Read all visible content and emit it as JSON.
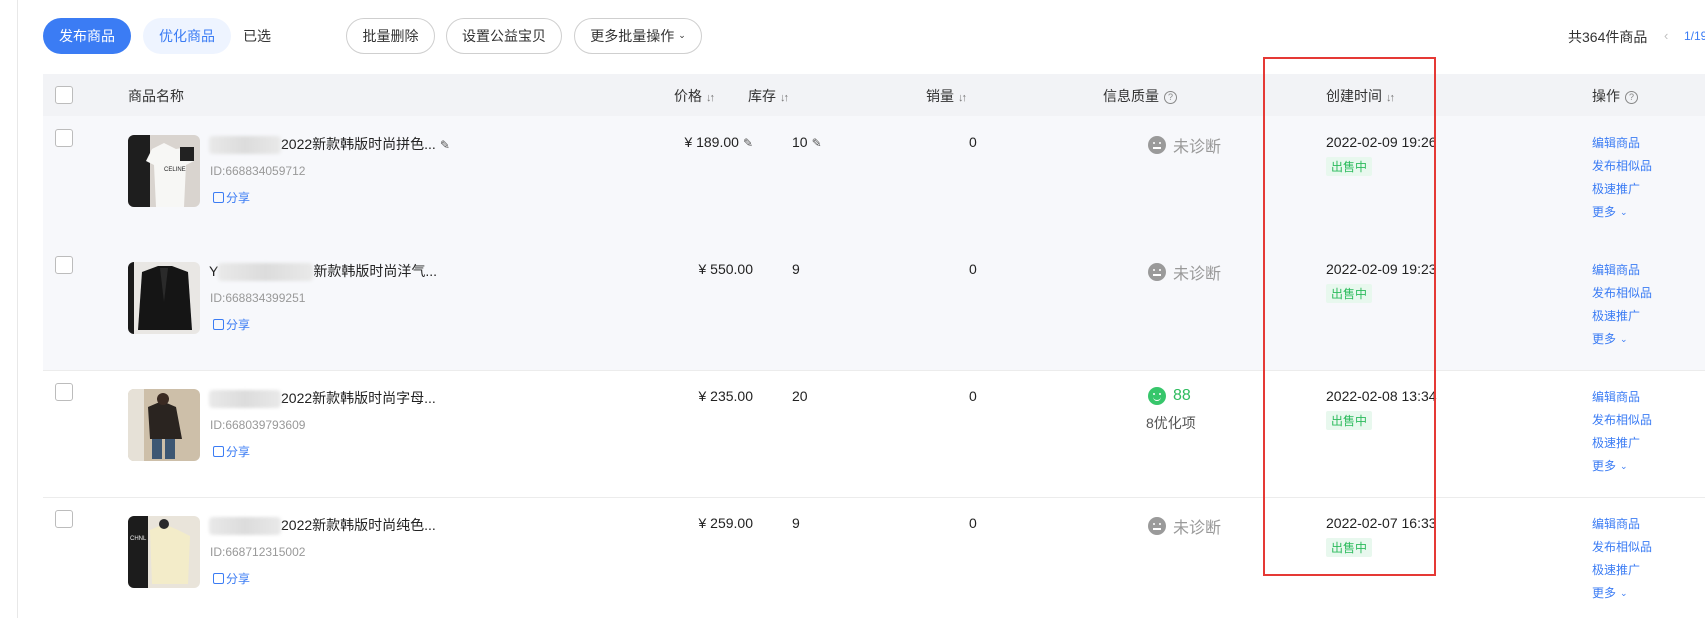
{
  "toolbar": {
    "publish": "发布商品",
    "optimize": "优化商品",
    "selected": "已选",
    "batch_delete": "批量删除",
    "set_charity": "设置公益宝贝",
    "more_batch": "更多批量操作"
  },
  "summary": {
    "total": "共364件商品",
    "prev": "‹",
    "page": "1/19"
  },
  "table": {
    "headers": {
      "name": "商品名称",
      "price": "价格",
      "stock": "库存",
      "sales": "销量",
      "quality": "信息质量",
      "created": "创建时间",
      "actions": "操作"
    },
    "rows": [
      {
        "title_prefix": "",
        "title": "2022新款韩版时尚拼色...",
        "id": "ID:668834059712",
        "share": "分享",
        "price": "¥ 189.00",
        "stock": "10",
        "sales": "0",
        "quality": "未诊断",
        "quality_extra": "",
        "created": "2022-02-09 19:26",
        "status": "出售中"
      },
      {
        "title_prefix": "Y",
        "title": "新款韩版时尚洋气...",
        "id": "ID:668834399251",
        "share": "分享",
        "price": "¥ 550.00",
        "stock": "9",
        "sales": "0",
        "quality": "未诊断",
        "quality_extra": "",
        "created": "2022-02-09 19:23",
        "status": "出售中"
      },
      {
        "title_prefix": "",
        "title": "2022新款韩版时尚字母...",
        "id": "ID:668039793609",
        "share": "分享",
        "price": "¥ 235.00",
        "stock": "20",
        "sales": "0",
        "quality": "88",
        "quality_extra": "8优化项",
        "created": "2022-02-08 13:34",
        "status": "出售中"
      },
      {
        "title_prefix": "",
        "title": "2022新款韩版时尚纯色...",
        "id": "ID:668712315002",
        "share": "分享",
        "price": "¥ 259.00",
        "stock": "9",
        "sales": "0",
        "quality": "未诊断",
        "quality_extra": "",
        "created": "2022-02-07 16:33",
        "status": "出售中"
      }
    ]
  },
  "row_actions": {
    "edit": "编辑商品",
    "publish_similar": "发布相似品",
    "quick_promote": "极速推广",
    "more": "更多"
  },
  "colors": {
    "primary": "#3b7cf4",
    "success": "#2dbb5d",
    "highlight": "#e53935"
  }
}
